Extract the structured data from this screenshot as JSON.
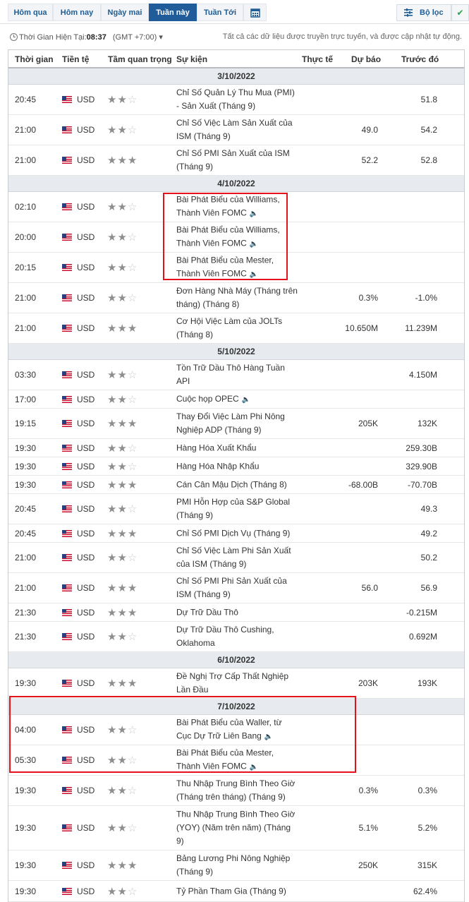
{
  "tabs": [
    {
      "label": "Hôm qua"
    },
    {
      "label": "Hôm nay"
    },
    {
      "label": "Ngày mai"
    },
    {
      "label": "Tuần này",
      "active": true
    },
    {
      "label": "Tuần Tới"
    }
  ],
  "calendar_icon": "calendar-icon",
  "filter": {
    "label": "Bộ lọc",
    "icon": "filter-icon"
  },
  "check_icon": "check-icon",
  "clock": {
    "label": "Thời Gian Hiện Tại:",
    "time": "08:37",
    "tz": "(GMT +7:00)"
  },
  "notice": "Tất cả các dữ liệu được truyền trực tuyến, và được cập nhật tự động.",
  "columns": {
    "time": "Thời gian",
    "currency": "Tiền tệ",
    "importance": "Tầm quan trọng",
    "event": "Sự kiện",
    "actual": "Thực tế",
    "forecast": "Dự báo",
    "previous": "Trước đó"
  },
  "colors": {
    "accent": "#1f5c99",
    "highlight": "#e3121b",
    "date_bg": "#e7eaee"
  },
  "days": [
    {
      "date": "3/10/2022",
      "events": [
        {
          "time": "20:45",
          "currency": "USD",
          "stars": 2,
          "event": "Chỉ Số Quản Lý Thu Mua (PMI) - Sản Xuất (Tháng 9)",
          "forecast": "",
          "previous": "51.8",
          "speech": false
        },
        {
          "time": "21:00",
          "currency": "USD",
          "stars": 2,
          "event": "Chỉ Số Việc Làm Sản Xuất của ISM (Tháng 9)",
          "forecast": "49.0",
          "previous": "54.2",
          "speech": false
        },
        {
          "time": "21:00",
          "currency": "USD",
          "stars": 3,
          "event": "Chỉ Số PMI Sản Xuất của ISM (Tháng 9)",
          "forecast": "52.2",
          "previous": "52.8",
          "speech": false
        }
      ]
    },
    {
      "date": "4/10/2022",
      "events": [
        {
          "time": "02:10",
          "currency": "USD",
          "stars": 2,
          "event": "Bài Phát Biểu của Williams, Thành Viên FOMC",
          "forecast": "",
          "previous": "",
          "speech": true
        },
        {
          "time": "20:00",
          "currency": "USD",
          "stars": 2,
          "event": "Bài Phát Biểu của Williams, Thành Viên FOMC",
          "forecast": "",
          "previous": "",
          "speech": true
        },
        {
          "time": "20:15",
          "currency": "USD",
          "stars": 2,
          "event": "Bài Phát Biểu của Mester, Thành Viên FOMC",
          "forecast": "",
          "previous": "",
          "speech": true
        },
        {
          "time": "21:00",
          "currency": "USD",
          "stars": 2,
          "event": "Đơn Hàng Nhà Máy (Tháng trên tháng) (Tháng 8)",
          "forecast": "0.3%",
          "previous": "-1.0%",
          "speech": false
        },
        {
          "time": "21:00",
          "currency": "USD",
          "stars": 3,
          "event": "Cơ Hội Việc Làm của JOLTs (Tháng 8)",
          "forecast": "10.650M",
          "previous": "11.239M",
          "speech": false
        }
      ]
    },
    {
      "date": "5/10/2022",
      "events": [
        {
          "time": "03:30",
          "currency": "USD",
          "stars": 2,
          "event": "Tồn Trữ Dầu Thô Hàng Tuần API",
          "forecast": "",
          "previous": "4.150M",
          "speech": false
        },
        {
          "time": "17:00",
          "currency": "USD",
          "stars": 2,
          "event": "Cuộc họp OPEC",
          "forecast": "",
          "previous": "",
          "speech": true
        },
        {
          "time": "19:15",
          "currency": "USD",
          "stars": 3,
          "event": "Thay Đổi Việc Làm Phi Nông Nghiệp ADP (Tháng 9)",
          "forecast": "205K",
          "previous": "132K",
          "speech": false
        },
        {
          "time": "19:30",
          "currency": "USD",
          "stars": 2,
          "event": "Hàng Hóa Xuất Khẩu",
          "forecast": "",
          "previous": "259.30B",
          "speech": false
        },
        {
          "time": "19:30",
          "currency": "USD",
          "stars": 2,
          "event": "Hàng Hóa Nhập Khẩu",
          "forecast": "",
          "previous": "329.90B",
          "speech": false
        },
        {
          "time": "19:30",
          "currency": "USD",
          "stars": 3,
          "event": "Cán Cân Mậu Dịch (Tháng 8)",
          "forecast": "-68.00B",
          "previous": "-70.70B",
          "speech": false
        },
        {
          "time": "20:45",
          "currency": "USD",
          "stars": 2,
          "event": "PMI Hỗn Hợp của S&P Global (Tháng 9)",
          "forecast": "",
          "previous": "49.3",
          "speech": false
        },
        {
          "time": "20:45",
          "currency": "USD",
          "stars": 3,
          "event": "Chỉ Số PMI Dịch Vụ (Tháng 9)",
          "forecast": "",
          "previous": "49.2",
          "speech": false
        },
        {
          "time": "21:00",
          "currency": "USD",
          "stars": 2,
          "event": "Chỉ Số Việc Làm Phi Sản Xuất của ISM (Tháng 9)",
          "forecast": "",
          "previous": "50.2",
          "speech": false
        },
        {
          "time": "21:00",
          "currency": "USD",
          "stars": 3,
          "event": "Chỉ Số PMI Phi Sản Xuất của ISM (Tháng 9)",
          "forecast": "56.0",
          "previous": "56.9",
          "speech": false
        },
        {
          "time": "21:30",
          "currency": "USD",
          "stars": 3,
          "event": "Dự Trữ Dầu Thô",
          "forecast": "",
          "previous": "-0.215M",
          "speech": false
        },
        {
          "time": "21:30",
          "currency": "USD",
          "stars": 2,
          "event": "Dự Trữ Dầu Thô Cushing, Oklahoma",
          "forecast": "",
          "previous": "0.692M",
          "speech": false
        }
      ]
    },
    {
      "date": "6/10/2022",
      "events": [
        {
          "time": "19:30",
          "currency": "USD",
          "stars": 3,
          "event": "Đề Nghị Trợ Cấp Thất Nghiệp Lần Đầu",
          "forecast": "203K",
          "previous": "193K",
          "speech": false
        }
      ]
    },
    {
      "date": "7/10/2022",
      "events": [
        {
          "time": "04:00",
          "currency": "USD",
          "stars": 2,
          "event": "Bài Phát Biểu của Waller, từ Cục Dự Trữ Liên Bang",
          "forecast": "",
          "previous": "",
          "speech": true
        },
        {
          "time": "05:30",
          "currency": "USD",
          "stars": 2,
          "event": "Bài Phát Biểu của Mester, Thành Viên FOMC",
          "forecast": "",
          "previous": "",
          "speech": true
        },
        {
          "time": "19:30",
          "currency": "USD",
          "stars": 2,
          "event": "Thu Nhập Trung Bình Theo Giờ (Tháng trên tháng) (Tháng 9)",
          "forecast": "0.3%",
          "previous": "0.3%",
          "speech": false
        },
        {
          "time": "19:30",
          "currency": "USD",
          "stars": 2,
          "event": "Thu Nhập Trung Bình Theo Giờ (YOY) (Năm trên năm) (Tháng 9)",
          "forecast": "5.1%",
          "previous": "5.2%",
          "speech": false
        },
        {
          "time": "19:30",
          "currency": "USD",
          "stars": 3,
          "event": "Bảng Lương Phi Nông Nghiệp (Tháng 9)",
          "forecast": "250K",
          "previous": "315K",
          "speech": false
        },
        {
          "time": "19:30",
          "currency": "USD",
          "stars": 2,
          "event": "Tỷ Phần Tham Gia (Tháng 9)",
          "forecast": "",
          "previous": "62.4%",
          "speech": false
        }
      ]
    }
  ]
}
